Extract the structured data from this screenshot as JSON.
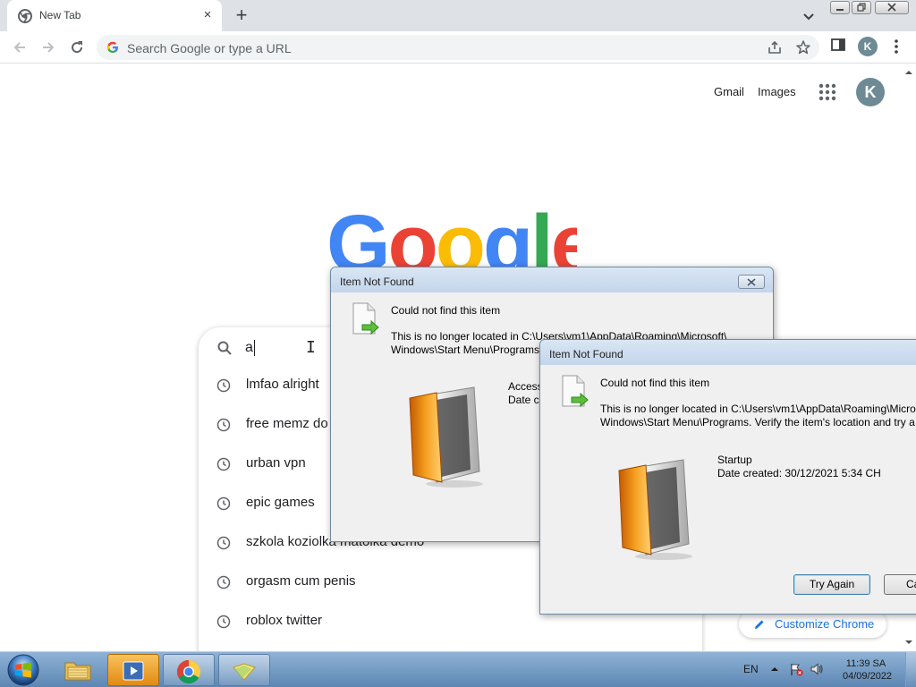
{
  "browser": {
    "tab_title": "New Tab",
    "tab_close": "×",
    "new_tab": "+",
    "omnibox_placeholder": "Search Google or type a URL",
    "profile_initial": "K"
  },
  "page": {
    "links": {
      "gmail": "Gmail",
      "images": "Images"
    },
    "avatar_initial": "K",
    "logo_text": "Google",
    "search": {
      "query": "a",
      "suggestions": [
        "lmfao alright",
        "free memz do",
        "urban vpn",
        "epic games",
        "szkola koziolka matolka demo",
        "orgasm cum penis",
        "roblox twitter"
      ]
    },
    "customize_label": "Customize Chrome"
  },
  "dialog1": {
    "title": "Item Not Found",
    "heading": "Could not find this item",
    "message_line1": "This is no longer located in C:\\Users\\vm1\\AppData\\Roaming\\Microsoft\\",
    "message_line2": "Windows\\Start Menu\\Programs",
    "info_line1": "Access",
    "info_line2": "Date cr"
  },
  "dialog2": {
    "title": "Item Not Found",
    "heading": "Could not find this item",
    "message_line1": "This is no longer located in C:\\Users\\vm1\\AppData\\Roaming\\Micro",
    "message_line2": "Windows\\Start Menu\\Programs. Verify the item's location and try a",
    "info_name": "Startup",
    "info_date": "Date created: 30/12/2021 5:34 CH",
    "try_again": "Try Again",
    "cancel_partial": "Ca"
  },
  "taskbar": {
    "language": "EN",
    "time": "11:39 SA",
    "date": "04/09/2022"
  },
  "colors": {
    "google_blue": "#4285F4",
    "google_red": "#EA4335",
    "google_yellow": "#FBBC05",
    "google_green": "#34A853",
    "link_blue": "#1a73e8"
  }
}
